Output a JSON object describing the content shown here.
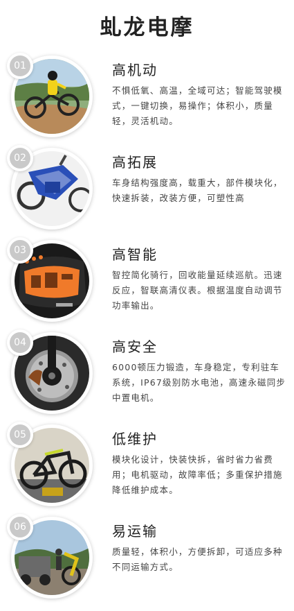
{
  "page": {
    "title": "虬龙电摩"
  },
  "features": [
    {
      "num": "01",
      "title": "高机动",
      "desc": "不惧低氧、高温，全域可达；智能驾驶模式，一键切换，易操作；体积小，质量轻，灵活机动。",
      "icon": "dirt-bike-jump"
    },
    {
      "num": "02",
      "title": "高拓展",
      "desc": "车身结构强度高，载重大，部件模块化，快速拆装，改装方便，可塑性高",
      "icon": "bike-frame"
    },
    {
      "num": "03",
      "title": "高智能",
      "desc": "智控简化骑行，回收能量延续巡航。迅速反应，智联高清仪表。根据温度自动调节功率输出。",
      "icon": "dashboard-display"
    },
    {
      "num": "04",
      "title": "高安全",
      "desc": "6000顿压力锻造，车身稳定，专利驻车系统，IP67级别防水电池，高速永磁同步中置电机。",
      "icon": "brake-disc"
    },
    {
      "num": "05",
      "title": "低维护",
      "desc": "模块化设计，快装快拆，省时省力省费用；电机驱动，故障率低；多重保护措施降低维护成本。",
      "icon": "electric-bike"
    },
    {
      "num": "06",
      "title": "易运输",
      "desc": "质量轻，体积小，方便拆卸，可适应多种不同运输方式。",
      "icon": "vehicle-transport"
    }
  ],
  "colors": {
    "badge": "#c9c9c9",
    "title": "#222222",
    "text": "#444444",
    "display": "#f07a2a"
  }
}
